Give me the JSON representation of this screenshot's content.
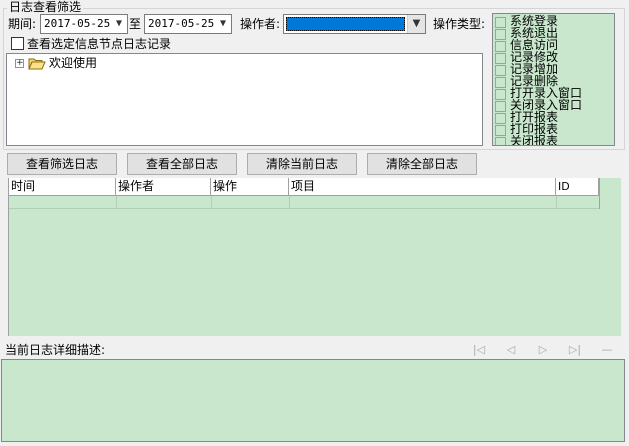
{
  "filter_group": {
    "title": "日志查看筛选",
    "period_label": "期间:",
    "date_from": "2017-05-25",
    "to_label": "至",
    "date_to": "2017-05-25",
    "operator_label": "操作者:",
    "operator_value": "",
    "op_type_label": "操作类型:",
    "view_selected_node_label": "查看选定信息节点日志记录"
  },
  "tree": {
    "root_label": "欢迎使用"
  },
  "operation_types": [
    "系统登录",
    "系统退出",
    "信息访问",
    "记录修改",
    "记录增加",
    "记录删除",
    "打开录入窗口",
    "关闭录入窗口",
    "打开报表",
    "打印报表",
    "关闭报表"
  ],
  "buttons": {
    "view_filtered": "查看筛选日志",
    "view_all": "查看全部日志",
    "clear_current": "清除当前日志",
    "clear_all": "清除全部日志"
  },
  "log_table": {
    "columns": [
      "时间",
      "操作者",
      "操作",
      "项目",
      "ID"
    ]
  },
  "detail": {
    "label": "当前日志详细描述:",
    "nav": [
      "|◁",
      "◁",
      "▷",
      "▷|",
      "—"
    ]
  },
  "colors": {
    "panel_green": "#c9e7cd",
    "selection_blue": "#0078d7"
  }
}
